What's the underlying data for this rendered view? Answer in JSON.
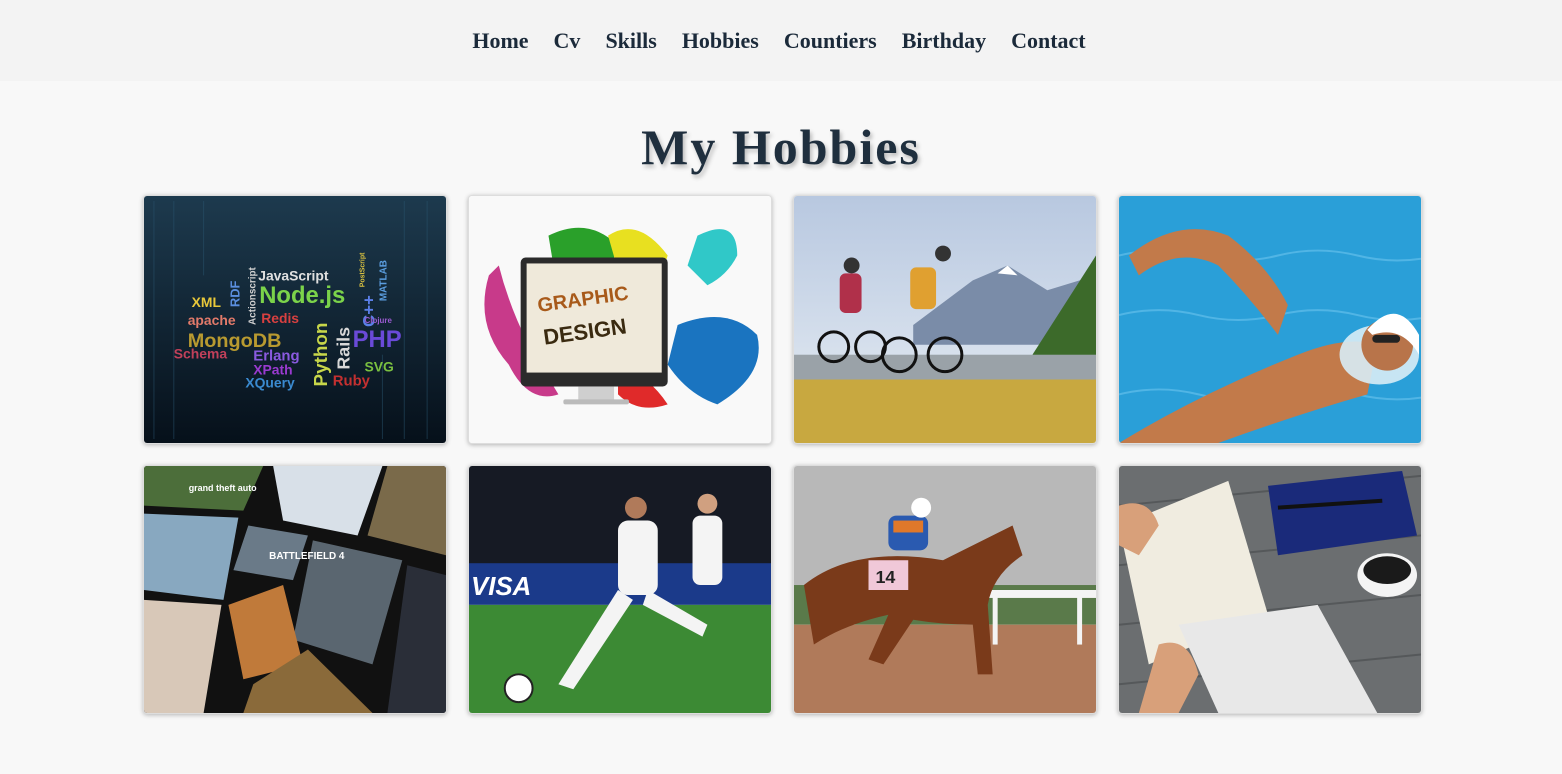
{
  "nav": {
    "items": [
      {
        "label": "Home"
      },
      {
        "label": "Cv"
      },
      {
        "label": "Skills"
      },
      {
        "label": "Hobbies"
      },
      {
        "label": "Countiers"
      },
      {
        "label": "Birthday"
      },
      {
        "label": "Contact"
      }
    ]
  },
  "page": {
    "title": "My Hobbies"
  },
  "hobbies": [
    {
      "name": "programming",
      "words": [
        "JavaScript",
        "Node.js",
        "XML",
        "RDF",
        "apache",
        "Redis",
        "MongoDB",
        "Python",
        "Rails",
        "PHP",
        "C++",
        "MATLAB",
        "Schema",
        "Erlang",
        "XPath",
        "SVG",
        "XQuery",
        "Ruby",
        "Actionscript",
        "PostScript",
        "Clojure"
      ]
    },
    {
      "name": "graphic-design",
      "screen_text": [
        "GRAPHIC",
        "DESIGN"
      ]
    },
    {
      "name": "cycling"
    },
    {
      "name": "swimming"
    },
    {
      "name": "gaming",
      "game_titles": [
        "grand theft auto",
        "BATTLEFIELD 4"
      ]
    },
    {
      "name": "football",
      "ad_text": "VISA"
    },
    {
      "name": "horse-racing",
      "saddle_number": "14"
    },
    {
      "name": "reading"
    }
  ],
  "colors": {
    "nav_bg": "#f3f3f3",
    "page_bg": "#f8f8f8",
    "text_dark": "#1b2a3a"
  }
}
